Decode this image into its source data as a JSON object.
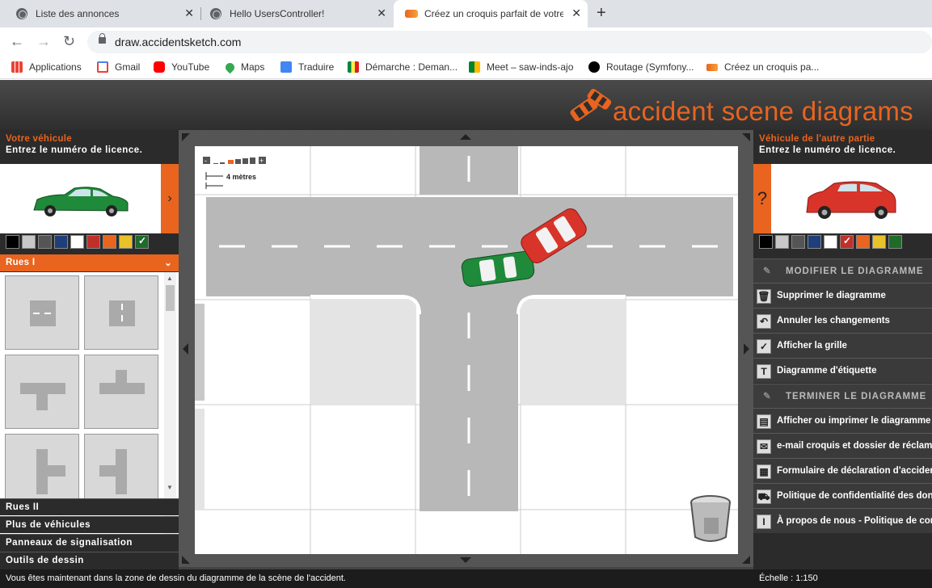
{
  "browser": {
    "tabs": [
      {
        "title": "Liste des annonces"
      },
      {
        "title": "Hello UsersController!"
      },
      {
        "title": "Créez un croquis parfait de votre"
      }
    ],
    "url": "draw.accidentsketch.com",
    "bookmarks": [
      {
        "label": "Applications",
        "icon": "apps-grid-icon"
      },
      {
        "label": "Gmail",
        "icon": "gmail-icon"
      },
      {
        "label": "YouTube",
        "icon": "youtube-icon"
      },
      {
        "label": "Maps",
        "icon": "maps-icon"
      },
      {
        "label": "Traduire",
        "icon": "translate-icon"
      },
      {
        "label": "Démarche : Deman...",
        "icon": "flag-icon"
      },
      {
        "label": "Meet – saw-inds-ajo",
        "icon": "meet-icon"
      },
      {
        "label": "Routage (Symfony...",
        "icon": "symfony-icon"
      },
      {
        "label": "Créez un croquis pa...",
        "icon": "car-icon"
      }
    ]
  },
  "header": {
    "logo_text": "accident scene diagrams"
  },
  "left_panel": {
    "title": "Votre véhicule",
    "subtitle": "Entrez le numéro de licence.",
    "toggle_symbol": "›",
    "car_color": "#1f8a3a",
    "swatches": [
      "#000000",
      "#c8c8c8",
      "#555555",
      "#1e3f7a",
      "#ffffff",
      "#c0302a",
      "#e8641f",
      "#e8c22a",
      "#1f6b2a"
    ],
    "selected_swatch": 8,
    "sections": {
      "rues1": "Rues I",
      "rues2": "Rues II",
      "vehicles": "Plus de véhicules",
      "signs": "Panneaux de signalisation",
      "tools": "Outils de dessin"
    }
  },
  "canvas": {
    "scale_label": "4 mètres",
    "zoom_minus": "-",
    "zoom_plus": "+"
  },
  "right_panel": {
    "title": "Véhicule de l'autre partie",
    "subtitle": "Entrez le numéro de licence.",
    "question_symbol": "?",
    "car_color": "#d8342a",
    "swatches": [
      "#000000",
      "#c8c8c8",
      "#555555",
      "#1e3f7a",
      "#ffffff",
      "#c0302a",
      "#e8641f",
      "#e8c22a",
      "#1f6b2a"
    ],
    "selected_swatch": 5,
    "modify_header": "MODIFIER LE DIAGRAMME",
    "modify_items": [
      {
        "label": "Supprimer le diagramme",
        "icon": "trash-icon"
      },
      {
        "label": "Annuler les changements",
        "icon": "undo-icon"
      },
      {
        "label": "Afficher la grille",
        "icon": "checkbox-icon"
      },
      {
        "label": "Diagramme d'étiquette",
        "icon": "text-icon"
      }
    ],
    "finish_header": "TERMINER LE DIAGRAMME",
    "finish_items": [
      {
        "label": "Afficher ou imprimer le diagramme",
        "icon": "print-icon"
      },
      {
        "label": "e-mail croquis et dossier de réclamation",
        "icon": "mail-icon"
      },
      {
        "label": "Formulaire de déclaration d'accident",
        "icon": "form-icon"
      },
      {
        "label": "Politique de confidentialité des données",
        "icon": "car-policy-icon"
      },
      {
        "label": "À propos de nous - Politique de confidentialité",
        "icon": "info-icon"
      }
    ]
  },
  "status": {
    "message": "Vous êtes maintenant dans la zone de dessin du diagramme de la scène de l'accident.",
    "scale": "Échelle : 1:150"
  }
}
